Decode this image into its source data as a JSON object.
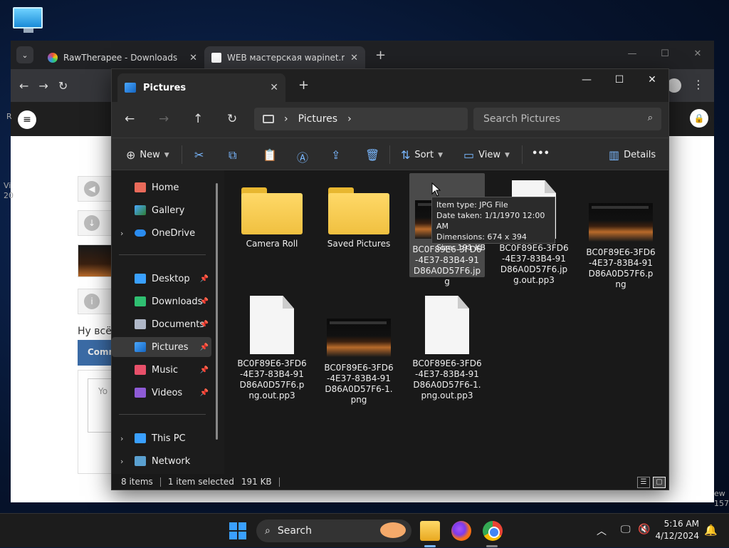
{
  "browser": {
    "tabs": [
      {
        "title": "RawTherapee - Downloads",
        "favicon_color": "#e74c3c"
      },
      {
        "title": "WEB мастерская wapinet.ru - B",
        "favicon_color": "#ffffff"
      }
    ],
    "page_text": "Ну всё",
    "comment_label": "Comm",
    "input_placeholder": "Yo",
    "left_edge_text": "R",
    "left_side_lines": [
      "Vi",
      "20"
    ],
    "right_side_lines": [
      "ew",
      "157"
    ]
  },
  "explorer": {
    "tab_title": "Pictures",
    "breadcrumb": "Pictures",
    "search_placeholder": "Search Pictures",
    "commands": {
      "new": "New",
      "sort": "Sort",
      "view": "View",
      "more": "•••",
      "details": "Details"
    },
    "nav": {
      "home": "Home",
      "gallery": "Gallery",
      "onedrive": "OneDrive",
      "desktop": "Desktop",
      "downloads": "Downloads",
      "documents": "Documents",
      "pictures": "Pictures",
      "music": "Music",
      "videos": "Videos",
      "thispc": "This PC",
      "network": "Network"
    },
    "files": [
      {
        "name": "Camera Roll",
        "kind": "folder"
      },
      {
        "name": "Saved Pictures",
        "kind": "folder"
      },
      {
        "name": "BC0F89E6-3FD6-4E37-83B4-91D86A0D57F6.jpg",
        "kind": "image",
        "selected": true
      },
      {
        "name": "BC0F89E6-3FD6-4E37-83B4-91D86A0D57F6.jpg.out.pp3",
        "kind": "doc"
      },
      {
        "name": "BC0F89E6-3FD6-4E37-83B4-91D86A0D57F6.png",
        "kind": "image"
      },
      {
        "name": "BC0F89E6-3FD6-4E37-83B4-91D86A0D57F6.png.out.pp3",
        "kind": "doc"
      },
      {
        "name": "BC0F89E6-3FD6-4E37-83B4-91D86A0D57F6-1.png",
        "kind": "image"
      },
      {
        "name": "BC0F89E6-3FD6-4E37-83B4-91D86A0D57F6-1.png.out.pp3",
        "kind": "doc"
      }
    ],
    "tooltip": {
      "line1": "Item type: JPG File",
      "line2": "Date taken: 1/1/1970 12:00 AM",
      "line3": "Dimensions: 674 x 394",
      "line4": "Size: 191 KB"
    },
    "status": {
      "items": "8 items",
      "selected": "1 item selected",
      "size": "191 KB"
    }
  },
  "taskbar": {
    "search_label": "Search",
    "time": "5:16 AM",
    "date": "4/12/2024"
  },
  "colors": {
    "accent": "#3aa0ff",
    "folder": "#f0c040"
  }
}
